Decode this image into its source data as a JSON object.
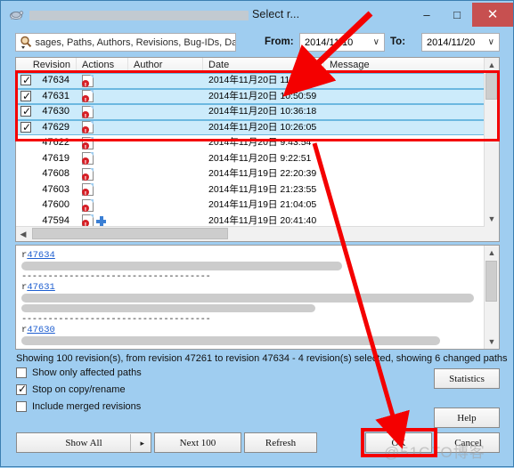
{
  "window": {
    "title_visible_tail": "Select r...",
    "title_redacted": true,
    "icon": "tortoisesvn-icon",
    "minimize": "–",
    "maximize": "□",
    "close": "✕"
  },
  "filter": {
    "search_placeholder": "ssages, Paths, Authors, Revisions, Bug-IDs, Date",
    "search_value": "",
    "search_icon": "search-icon",
    "from_label": "From:",
    "from_value": "2014/11/10",
    "to_label": "To:",
    "to_value": "2014/11/20",
    "dropdown_glyph": "∨"
  },
  "list": {
    "columns": [
      "Revision",
      "Actions",
      "Author",
      "Date",
      "Message"
    ],
    "rows": [
      {
        "checked": true,
        "checkbox": true,
        "revision": "47634",
        "actions": [
          "modified-doc-icon"
        ],
        "author": "",
        "date": "2014年11月20日 11:01:38",
        "message": "",
        "selected": true,
        "author_w": 62,
        "msg_w": 146
      },
      {
        "checked": true,
        "checkbox": true,
        "revision": "47631",
        "actions": [
          "modified-doc-icon"
        ],
        "author": "",
        "date": "2014年11月20日 10:50:59",
        "message": "",
        "selected": true,
        "author_w": 60,
        "msg_w": 172
      },
      {
        "checked": true,
        "checkbox": true,
        "revision": "47630",
        "actions": [
          "modified-doc-icon"
        ],
        "author": "",
        "date": "2014年11月20日 10:36:18",
        "message": "",
        "selected": true,
        "author_w": 58,
        "msg_w": 166
      },
      {
        "checked": true,
        "checkbox": true,
        "revision": "47629",
        "actions": [
          "modified-doc-icon"
        ],
        "author": "",
        "date": "2014年11月20日 10:26:05",
        "message": "",
        "selected": true,
        "author_w": 64,
        "msg_w": 176
      },
      {
        "checked": false,
        "checkbox": false,
        "revision": "47622",
        "actions": [
          "modified-doc-icon"
        ],
        "author": "",
        "date": "2014年11月20日 9:43:54",
        "message": "",
        "selected": false,
        "author_w": 66,
        "msg_w": 150
      },
      {
        "checked": false,
        "checkbox": false,
        "revision": "47619",
        "actions": [
          "modified-doc-icon"
        ],
        "author": "",
        "date": "2014年11月20日 9:22:51",
        "message": "",
        "selected": false,
        "author_w": 58,
        "msg_w": 132
      },
      {
        "checked": false,
        "checkbox": false,
        "revision": "47608",
        "actions": [
          "modified-doc-icon"
        ],
        "author": "",
        "date": "2014年11月19日 22:20:39",
        "message": "",
        "selected": false,
        "author_w": 56,
        "msg_w": 164
      },
      {
        "checked": false,
        "checkbox": false,
        "revision": "47603",
        "actions": [
          "modified-doc-icon"
        ],
        "author": "",
        "date": "2014年11月19日 21:23:55",
        "message": "",
        "selected": false,
        "author_w": 34,
        "msg_w": 170
      },
      {
        "checked": false,
        "checkbox": false,
        "revision": "47600",
        "actions": [
          "modified-doc-icon"
        ],
        "author": "",
        "date": "2014年11月19日 21:04:05",
        "message": "",
        "selected": false,
        "author_w": 56,
        "msg_w": 158
      },
      {
        "checked": false,
        "checkbox": false,
        "revision": "47594",
        "actions": [
          "modified-doc-icon",
          "added-icon"
        ],
        "author": "",
        "date": "2014年11月19日 20:41:40",
        "message": "",
        "selected": false,
        "author_w": 68,
        "msg_w": 178
      },
      {
        "checked": false,
        "checkbox": false,
        "revision": "47588",
        "actions": [
          "modified-doc-icon"
        ],
        "author": "",
        "date": "2014年11月19日 20:22:40",
        "message": "",
        "selected": false,
        "author_w": 48,
        "msg_w": 160
      }
    ]
  },
  "log": {
    "entries": [
      {
        "prefix": "r",
        "revision": "47634",
        "body_w": 360,
        "second_w": 0
      },
      {
        "prefix": "r",
        "revision": "47631",
        "body_w": 508,
        "second_w": 330
      },
      {
        "prefix": "r",
        "revision": "47630",
        "body_w": 470,
        "second_w": 0
      }
    ],
    "separator": "------------------------------------"
  },
  "status": {
    "text": "Showing 100 revision(s), from revision 47261 to revision 47634 - 4 revision(s) selected, showing 6 changed paths"
  },
  "options": [
    {
      "label": "Show only affected paths",
      "checked": false,
      "name": "show-only-affected-paths"
    },
    {
      "label": "Stop on copy/rename",
      "checked": true,
      "name": "stop-on-copy-rename"
    },
    {
      "label": "Include merged revisions",
      "checked": false,
      "name": "include-merged-revisions"
    }
  ],
  "buttons": {
    "statistics": "Statistics",
    "help": "Help",
    "show_all": "Show All",
    "show_all_arrow": "▸",
    "next_100": "Next 100",
    "refresh": "Refresh",
    "ok": "OK",
    "cancel": "Cancel"
  },
  "watermark": "@51CTO博客",
  "annotations": {
    "arrow_color": "#f40000",
    "highlight_rows_box": "selected-revisions-highlight",
    "highlight_ok_box": "ok-button-highlight"
  }
}
